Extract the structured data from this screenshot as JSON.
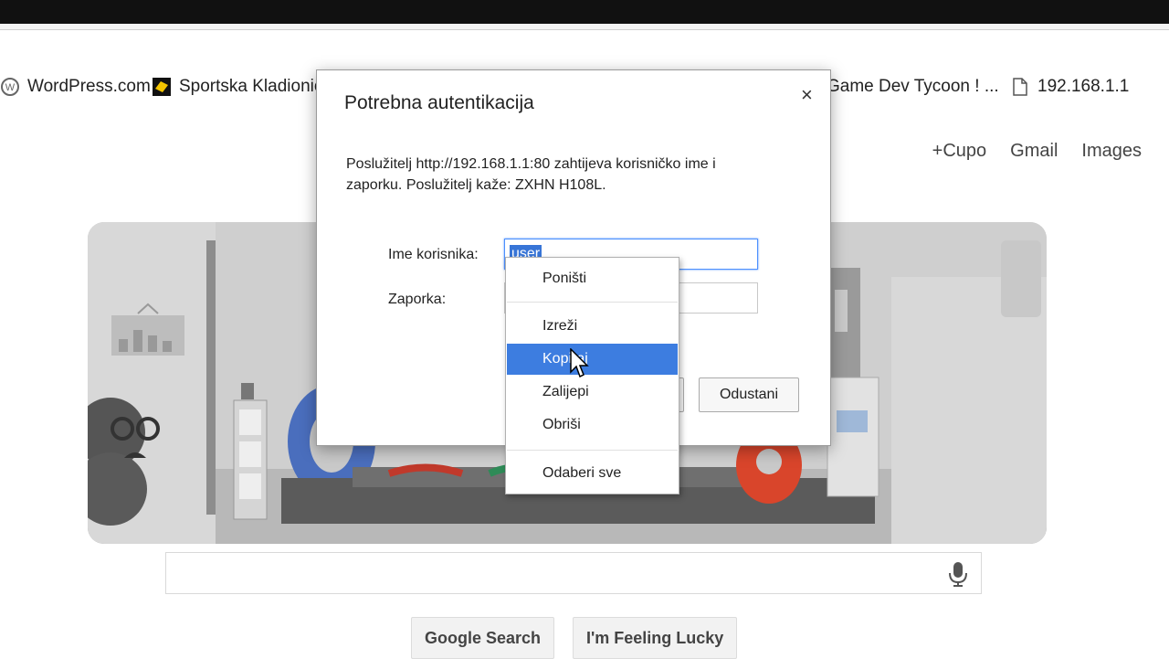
{
  "bookmarks": [
    {
      "label": "WordPress.com",
      "icon": "wordpress-icon"
    },
    {
      "label": "Sportska Kladionic",
      "icon": "kladionica-icon"
    },
    {
      "label": "Game Dev Tycoon ! ...",
      "icon": ""
    },
    {
      "label": "192.168.1.1",
      "icon": "page-icon"
    }
  ],
  "header_links": [
    "+Cupo",
    "Gmail",
    "Images"
  ],
  "search": {
    "value": "",
    "mic_icon": "microphone-icon"
  },
  "buttons": {
    "search": "Google Search",
    "lucky": "I'm Feeling Lucky"
  },
  "dialog": {
    "title": "Potrebna autentikacija",
    "close": "×",
    "message_line1": "Poslužitelj http://192.168.1.1:80 zahtijeva korisničko ime i",
    "message_line2": "zaporku. Poslužitelj kaže: ZXHN H108L.",
    "username_label": "Ime korisnika:",
    "username_value": "user",
    "password_label": "Zaporka:",
    "password_value": "",
    "cancel": "Odustani"
  },
  "context_menu": {
    "items": [
      "Poništi",
      "Izreži",
      "Kopiraj",
      "Zalijepi",
      "Obriši",
      "Odaberi sve"
    ],
    "highlighted": "Kopiraj"
  },
  "colors": {
    "selection": "#3875d7",
    "menu_highlight": "#3d7de0",
    "focus_border": "#4d90fe"
  }
}
